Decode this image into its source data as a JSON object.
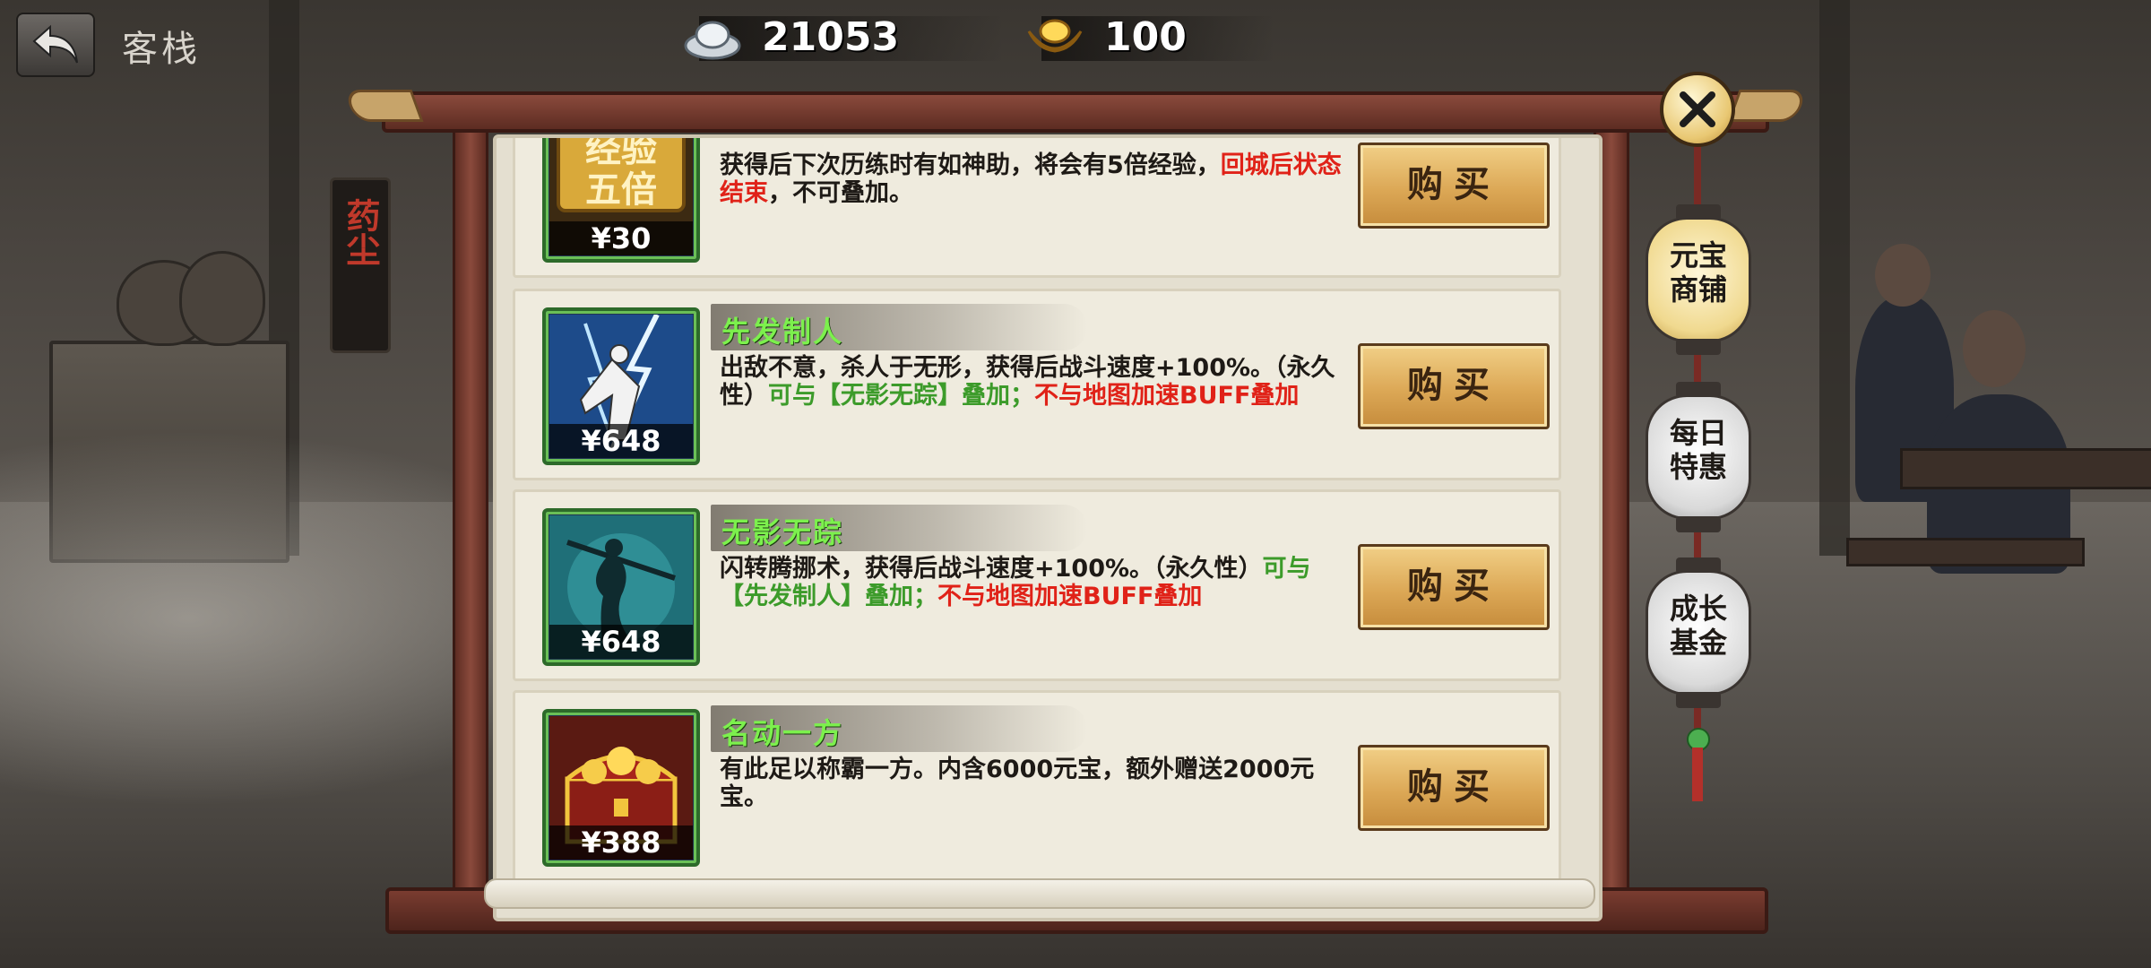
{
  "topbar": {
    "title": "客栈",
    "silver": "21053",
    "gold": "100"
  },
  "sign": {
    "text": "药尘"
  },
  "shop": {
    "buy_label": "购买",
    "items": [
      {
        "title": "",
        "price": "¥30",
        "desc_plain": "获得后下次历练时有如神助，将会有5倍经验，",
        "desc_red": "回城后状态结束",
        "desc_tail": "，不可叠加。",
        "icon": "exp-5x-icon"
      },
      {
        "title": "先发制人",
        "price": "¥648",
        "desc_plain": "出敌不意，杀人于无形，获得后战斗速度+100%。（永久性）",
        "desc_green": "可与【无影无踪】叠加；",
        "desc_red": "不与地图加速BUFF叠加",
        "icon": "swordsman-lightning-icon"
      },
      {
        "title": "无影无踪",
        "price": "¥648",
        "desc_plain": "闪转腾挪术，获得后战斗速度+100%。（永久性）",
        "desc_green": "可与【先发制人】叠加；",
        "desc_red": "不与地图加速BUFF叠加",
        "icon": "shadow-swordsman-icon"
      },
      {
        "title": "名动一方",
        "price": "¥388",
        "desc_plain": "有此足以称霸一方。内含6000元宝，额外赠送2000元宝。",
        "icon": "treasure-chest-icon"
      }
    ]
  },
  "tabs": [
    {
      "label": "元宝商铺",
      "active": true
    },
    {
      "label": "每日特惠",
      "active": false
    },
    {
      "label": "成长基金",
      "active": false
    }
  ],
  "colors": {
    "title_green": "#7cf04d",
    "desc_red": "#e02218",
    "desc_green": "#3c9b2a",
    "frame": "#8a4a3c"
  }
}
